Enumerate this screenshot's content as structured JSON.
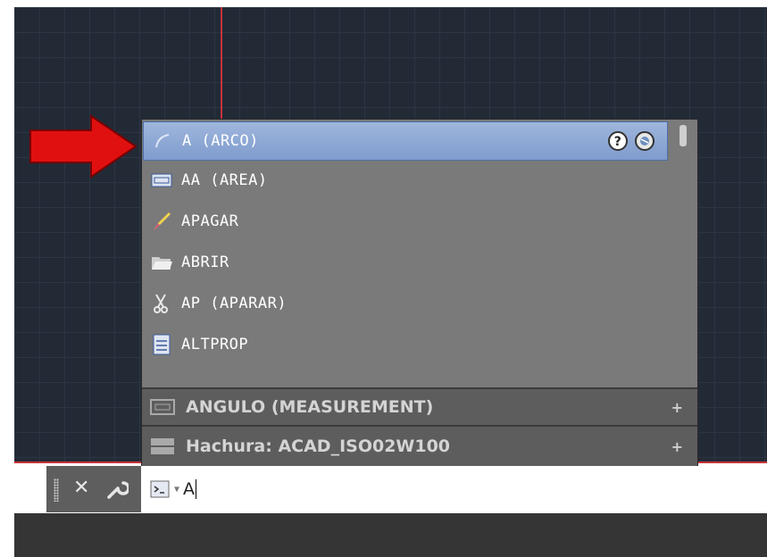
{
  "autocomplete": {
    "items": [
      {
        "label": "A (ARCO)",
        "icon": "arc-icon",
        "selected": true
      },
      {
        "label": "AA (AREA)",
        "icon": "area-icon",
        "selected": false
      },
      {
        "label": "APAGAR",
        "icon": "eraser-icon",
        "selected": false
      },
      {
        "label": "ABRIR",
        "icon": "folder-open-icon",
        "selected": false
      },
      {
        "label": "AP (APARAR)",
        "icon": "trim-scissors-icon",
        "selected": false
      },
      {
        "label": "ALTPROP",
        "icon": "properties-icon",
        "selected": false
      }
    ],
    "groups": [
      {
        "label": "ANGULO (MEASUREMENT)",
        "icon": "measure-icon",
        "expander": "+"
      },
      {
        "label": "Hachura: ACAD_ISO02W100",
        "icon": "hatch-icon",
        "expander": "+"
      }
    ]
  },
  "command_line": {
    "close": "✕",
    "input_value": "A"
  },
  "colors": {
    "canvas": "#222a36",
    "crosshair": "#c8323a",
    "selection": "#8ea9d8",
    "arrow": "#e01010"
  }
}
